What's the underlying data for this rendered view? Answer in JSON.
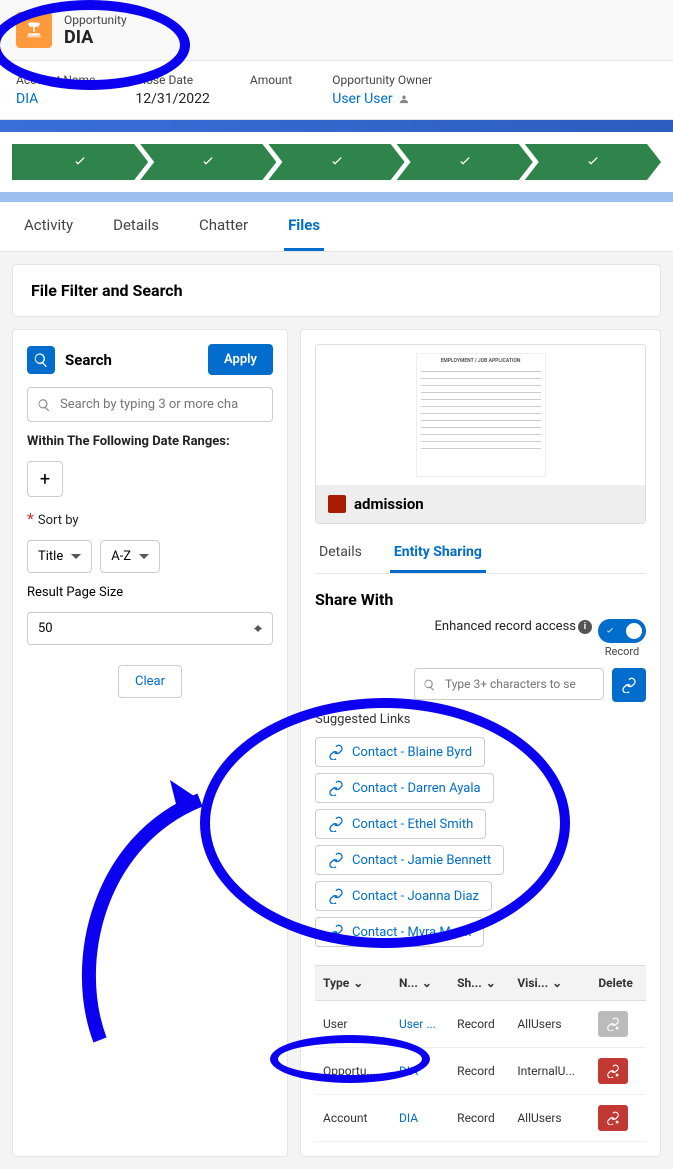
{
  "header": {
    "type": "Opportunity",
    "name": "DIA"
  },
  "fields": {
    "account": {
      "label": "Account Name",
      "value": "DIA"
    },
    "closeDate": {
      "label": "Close Date",
      "value": "12/31/2022"
    },
    "amount": {
      "label": "Amount",
      "value": ""
    },
    "owner": {
      "label": "Opportunity Owner",
      "value": "User User"
    }
  },
  "tabs": [
    "Activity",
    "Details",
    "Chatter",
    "Files"
  ],
  "activeTab": "Files",
  "filterTitle": "File Filter and Search",
  "search": {
    "title": "Search",
    "apply": "Apply",
    "placeholder": "Search by typing 3 or more cha",
    "dateRangeLabel": "Within The Following Date Ranges:",
    "sortLabel": "Sort by",
    "sortField": "Title",
    "sortDir": "A-Z",
    "pageSizeLabel": "Result Page Size",
    "pageSize": "50",
    "clear": "Clear"
  },
  "preview": {
    "docTitle": "EMPLOYMENT / JOB APPLICATION",
    "fileName": "admission"
  },
  "subTabs": [
    "Details",
    "Entity Sharing"
  ],
  "activeSubTab": "Entity Sharing",
  "share": {
    "title": "Share With",
    "enhancedLabel": "Enhanced record access",
    "toggleLabel": "Record",
    "linkPlaceholder": "Type 3+ characters to se",
    "suggestedLabel": "Suggested Links",
    "suggestions": [
      "Contact - Blaine Byrd",
      "Contact - Darren Ayala",
      "Contact - Ethel Smith",
      "Contact - Jamie Bennett",
      "Contact - Joanna Diaz",
      "Contact - Myra Mack"
    ]
  },
  "table": {
    "cols": [
      "Type",
      "N...",
      "Sh...",
      "Visi...",
      "Delete"
    ],
    "rows": [
      {
        "type": "User",
        "name": "User ...",
        "share": "Record",
        "vis": "AllUsers",
        "del": "disabled"
      },
      {
        "type": "Opportu...",
        "name": "DIA",
        "share": "Record",
        "vis": "InternalU...",
        "del": "red"
      },
      {
        "type": "Account",
        "name": "DIA",
        "share": "Record",
        "vis": "AllUsers",
        "del": "red"
      }
    ]
  }
}
